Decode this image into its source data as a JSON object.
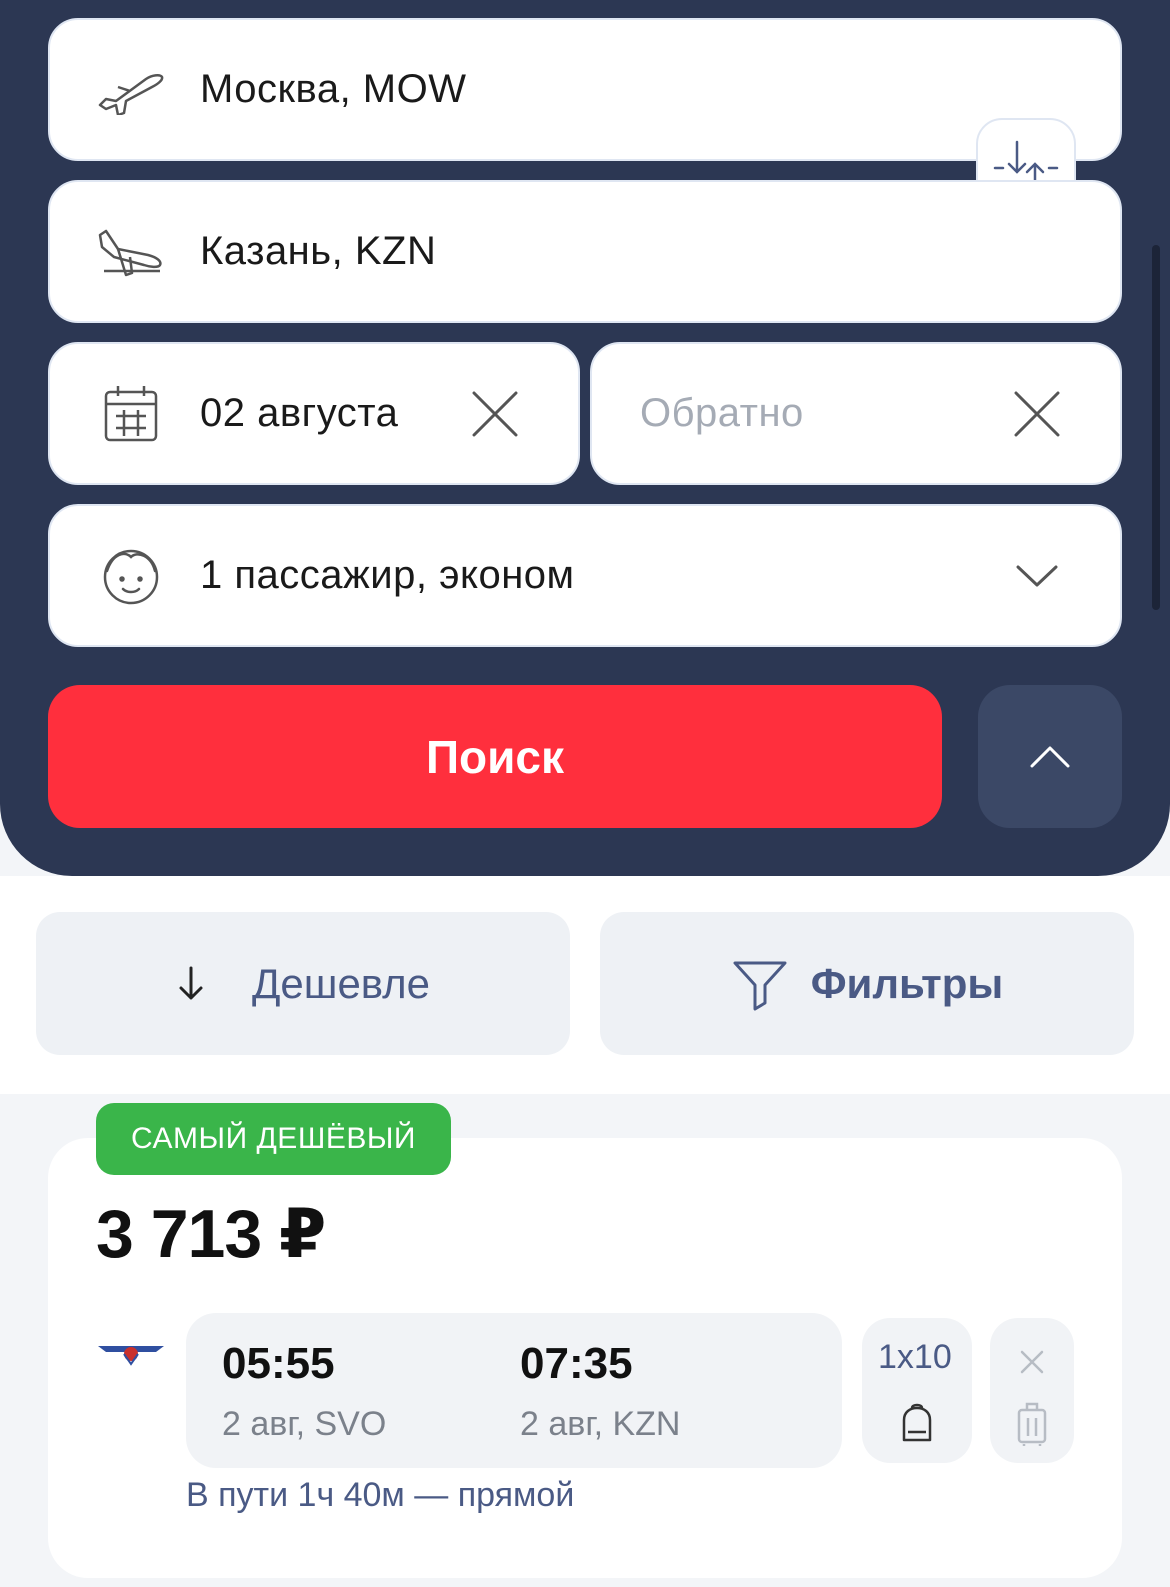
{
  "search": {
    "from": "Москва, MOW",
    "to": "Казань, KZN",
    "date_depart": "02 августа",
    "date_return_placeholder": "Обратно",
    "passengers": "1 пассажир, эконом",
    "search_label": "Поиск"
  },
  "sort": {
    "cheaper_label": "Дешевле",
    "filters_label": "Фильтры"
  },
  "result": {
    "badge": "САМЫЙ ДЕШЁВЫЙ",
    "price": "3 713 ₽",
    "depart_time": "05:55",
    "depart_info": "2 авг, SVO",
    "arrive_time": "07:35",
    "arrive_info": "2 авг, KZN",
    "baggage": "1x10",
    "duration": "В пути 1ч 40м — прямой"
  },
  "colors": {
    "panel": "#2c3753",
    "accent_red": "#ff2f3d",
    "badge_green": "#3ab54a",
    "link_blue": "#4a5a85"
  },
  "icons": [
    "takeoff-icon",
    "landing-icon",
    "swap-icon",
    "calendar-icon",
    "close-icon",
    "passenger-icon",
    "chevron-down-icon",
    "chevron-up-icon",
    "arrow-down-icon",
    "filter-icon",
    "airline-logo",
    "backpack-icon",
    "suitcase-icon"
  ]
}
